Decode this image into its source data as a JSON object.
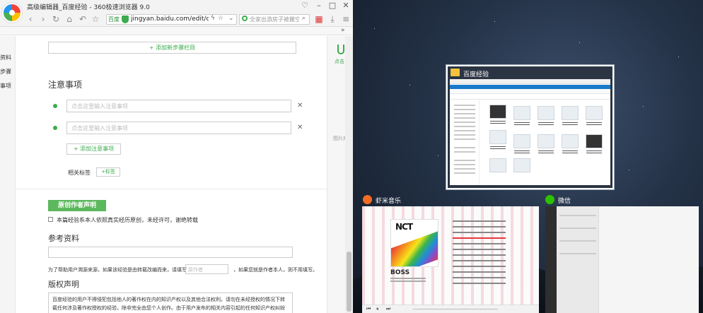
{
  "browser": {
    "window_title": "高级编辑器_百度经验 - 360极速浏览器 9.0",
    "address_badge": "百度",
    "url": "jingyan.baidu.com/edit/con",
    "search_placeholder": "全家出游房子被搬空",
    "bookmark_overflow": "»",
    "left_strip": [
      "资料",
      "步骤",
      "事项"
    ],
    "right_panel": {
      "label": "点击",
      "label2": "图片库"
    }
  },
  "editor": {
    "add_step_section": "+ 添加新步骤栏目",
    "notes_title": "注意事项",
    "note_placeholders": [
      "点击这里输入注意事项",
      "点击这里输入注意事项"
    ],
    "add_note": "+ 添加注意事项",
    "tags_label": "相关标签",
    "add_tag": "+标签",
    "original_button": "原创作者声明",
    "original_check": "本篇经验系本人依照真实经历原创，未经许可，谢绝转载",
    "references_title": "参考资料",
    "ref_hint": "为了帮助用户溯源来源，如果该经验是由转载改编而来，请填写",
    "ref_author_placeholder": "原作者",
    "ref_hint2": "，如果您就是作者本人，则不用填写。",
    "copyright_title": "版权声明",
    "copyright_text": "百度经验的用户不得侵犯包括他人的著作权在内的知识产权以及其他合法权利。请勿在未经授权的情况下转载任何涉及著作权授权的经验，除非完全由您个人创作。由于用户发布的相关内容引起的任何知识产权纠纷或其他法律"
  },
  "desktop": {
    "selected_window_title": "百度经验",
    "music_app_label": "虾米音乐",
    "music_song": "BOSS",
    "music_album_art_text": "NCT",
    "wechat_app_label": "微信"
  },
  "colors": {
    "accent_green": "#3bab4d",
    "original_button_bg": "#5cb85c"
  }
}
